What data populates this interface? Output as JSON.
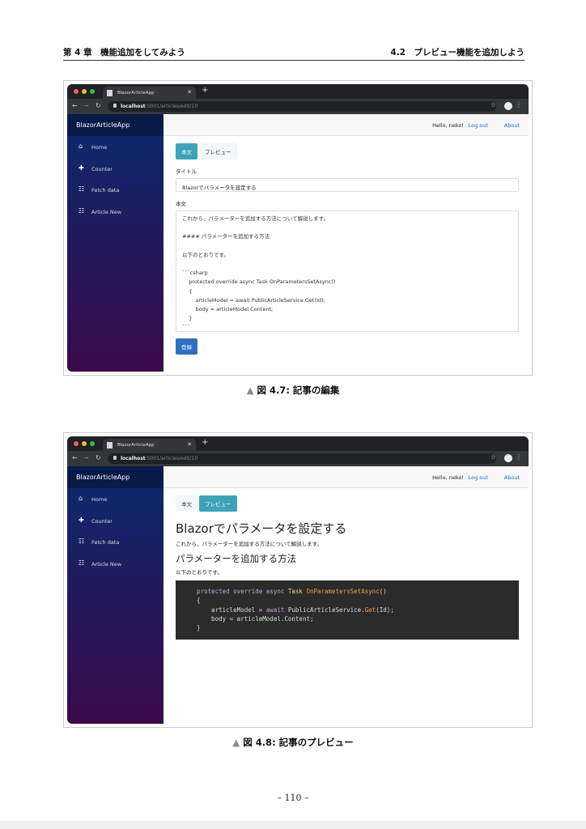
{
  "header": {
    "chapter": "第 4 章　機能追加をしてみよう",
    "section": "4.2　プレビュー機能を追加しよう"
  },
  "browser": {
    "tab_title": "BlazorArticleApp",
    "url_host": "localhost",
    "url_path": ":5001/articles/edit/10"
  },
  "app": {
    "brand": "BlazorArticleApp",
    "nav": [
      "Home",
      "Counter",
      "Fetch data",
      "Article New"
    ],
    "greeting": "Hello, neko!",
    "logout": "Log out",
    "about": "About"
  },
  "fig1": {
    "tab_body": "本文",
    "tab_preview": "プレビュー",
    "title_label": "タイトル",
    "title_value": "Blazorでパラメータを設定する",
    "body_label": "本文",
    "body_value": "これから、パラメーターを追加する方法について解説します。\n\n#### パラメーターを追加する方法\n\n以下のとおりです。\n\n```csharp\n    protected override async Task OnParametersSetAsync()\n    {\n        articleModel = await PublicArticleService.Get(Id);\n        body = articleModel.Content;\n    }\n```",
    "submit": "登録",
    "caption": "図 4.7: 記事の編集"
  },
  "fig2": {
    "tab_body": "本文",
    "tab_preview": "プレビュー",
    "h1": "Blazorでパラメータを設定する",
    "p1": "これから、パラメーターを追加する方法について解説します。",
    "h2": "パラメーターを追加する方法",
    "p2": "以下のとおりです。",
    "code": {
      "l1_kw": "protected override async ",
      "l1_ty": "Task ",
      "l1_fn": "OnParametersSetAsync",
      "l1_end": "()",
      "l2": "{",
      "l3_a": "    articleModel = ",
      "l3_kw": "await ",
      "l3_b": "PublicArticleService.",
      "l3_fn": "Get",
      "l3_c": "(Id);",
      "l4": "    body = articleModel.Content;",
      "l5": "}"
    },
    "caption": "図 4.8: 記事のプレビュー"
  },
  "caption_marker": "▲",
  "page_number": "– 110 –"
}
